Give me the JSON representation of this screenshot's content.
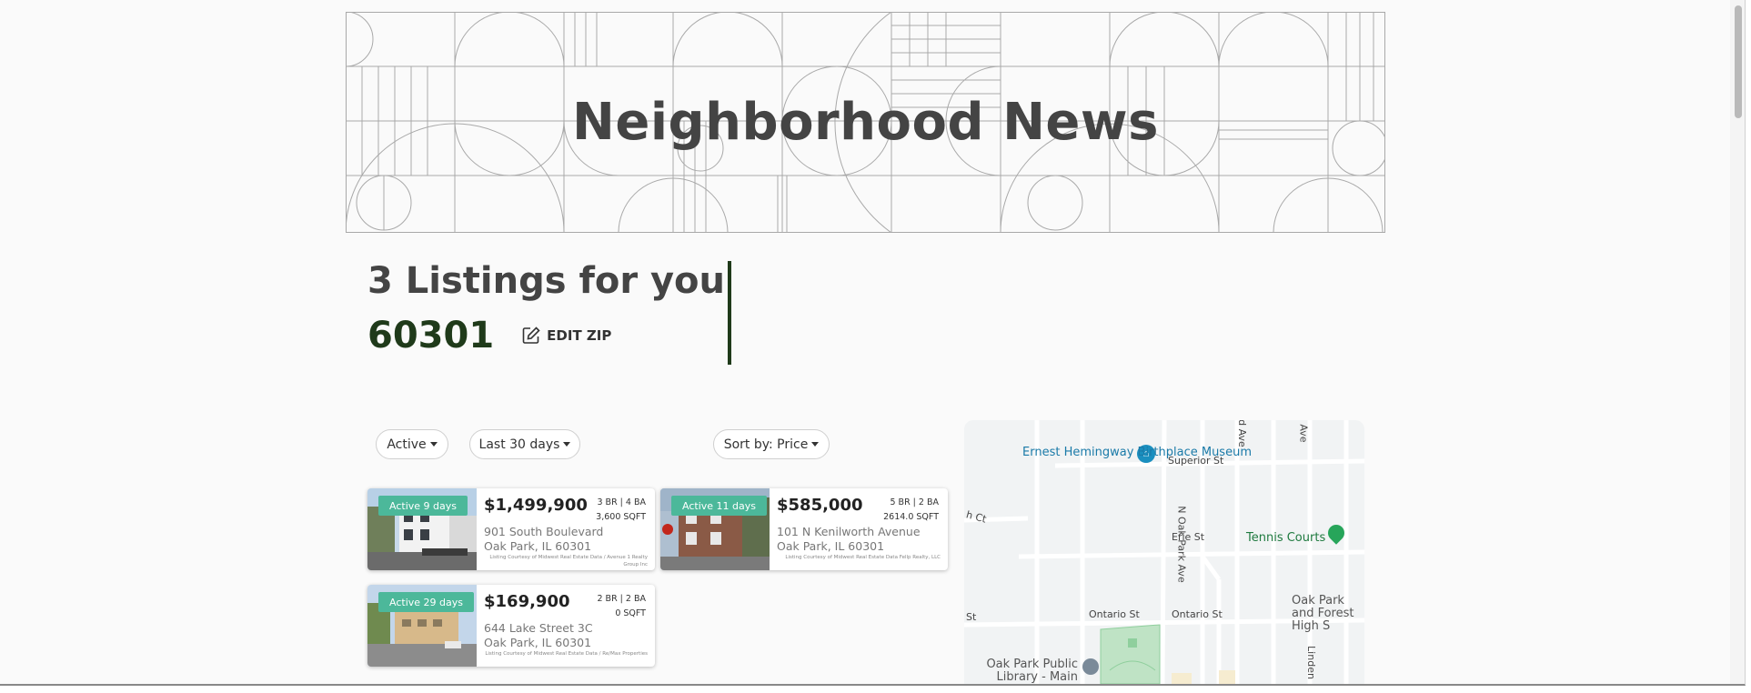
{
  "banner": {
    "title": "Neighborhood News"
  },
  "listings": {
    "heading": "3 Listings for you",
    "zip": "60301",
    "edit_zip_label": "EDIT ZIP"
  },
  "filters": {
    "status": "Active",
    "period": "Last 30 days",
    "sort": "Sort by: Price"
  },
  "cards": [
    {
      "badge": "Active 9 days",
      "price": "$1,499,900",
      "beds_baths": "3 BR | 4 BA",
      "sqft": "3,600 SQFT",
      "street": "901 South Boulevard",
      "city": "Oak Park, IL 60301",
      "courtesy": "Listing Courtesy of Midwest Real Estate Data / Avenue 1 Realty Group Inc"
    },
    {
      "badge": "Active 11 days",
      "price": "$585,000",
      "beds_baths": "5 BR | 2 BA",
      "sqft": "2614.0 SQFT",
      "street": "101 N Kenilworth Avenue",
      "city": "Oak Park, IL 60301",
      "courtesy": "Listing Courtesy of Midwest Real Estate Data Fellp Realty, LLC"
    },
    {
      "badge": "Active 29 days",
      "price": "$169,900",
      "beds_baths": "2 BR | 2 BA",
      "sqft": "0 SQFT",
      "street": "644 Lake Street 3C",
      "city": "Oak Park, IL 60301",
      "courtesy": "Listing Courtesy of Midwest Real Estate Data / Re/Max Properties"
    }
  ],
  "map": {
    "labels": {
      "hemingway": "Ernest Hemingway Birthplace Museum",
      "superior": "Superior St",
      "tennis": "Tennis Courts",
      "erie": "Erie St",
      "oak_park_ave": "N Oak Park Ave",
      "ontario1": "Ontario St",
      "ontario2": "Ontario St",
      "st_left": "St",
      "ct": "h Ct",
      "high_school": "Oak Park and Forest High S",
      "library": "Oak Park Public Library - Main Library",
      "linden": "Linden",
      "ave_top1": "d Ave",
      "ave_top2": "Ave"
    },
    "colors": {
      "poi_blue": "#1a8fbf",
      "poi_green": "#27a55a",
      "park": "#bfe3c5"
    }
  },
  "colors": {
    "accent_green": "#1f3a1a",
    "badge": "#4cb89a"
  }
}
